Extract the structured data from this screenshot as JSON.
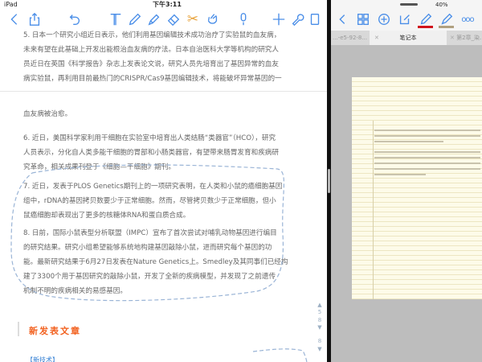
{
  "status_bar": {
    "device": "iPad",
    "time": "下午3:11",
    "battery": "40%"
  },
  "left_toolbar": {
    "icons": [
      "back-icon",
      "share-icon",
      "undo-icon",
      "text-icon",
      "pen-icon",
      "highlighter-icon",
      "eraser-icon",
      "scissors-icon",
      "hand-icon",
      "microphone-icon",
      "plus-icon",
      "wrench-icon",
      "page-icon"
    ],
    "active_color": "#e8a23a",
    "accent": "#4a8ee8"
  },
  "document": {
    "paragraphs": [
      [
        "5. 日本一个研究小组近日表示，他们利用基因编辑技术成功治疗了实验鼠的血友病，",
        "未来有望在此基础上开发出能根治血友病的疗法。日本自治医科大学等机构的研究人",
        "员近日在英国《科学报告》杂志上发表论文说，研究人员先培育出了基因异常的血友",
        "病实验鼠，再利用目前最热门的CRISPR/Cas9基因编辑技术，将能破坏异常基因的一"
      ],
      [
        "血友病被治愈。"
      ],
      [
        "6. 近日，美国科学家利用干细胞在实验室中培育出人类结肠“类器官”（HCO），研究",
        "人员表示，分化自人类多能干细胞的胃部和小肠类器官，有望带来肠胃发育和疾病研",
        "究革命，相关成果刊登于《细胞—干细胞》期刊。"
      ],
      [
        "7. 近日，发表于PLOS Genetics期刊上的一项研究表明，在人类和小鼠的癌细胞基因",
        "组中，rDNA的基因拷贝数要少于正常细胞。然而，尽管拷贝数少于正常细胞，但小",
        "鼠癌细胞却表现出了更多的核糖体RNA和蛋白质合成。"
      ],
      [
        "8. 日前，国际小鼠表型分析联盟（IMPC）宣布了首次尝试对哺乳动物基因进行编目",
        "的研究结果。研究小组希望能够系统地构建基因敲除小鼠，进而研究每个基因的功",
        "能。最新研究结果于6月27日发表在Nature Genetics上。Smedley及其同事们已经构",
        "建了3300个用于基因研究的敲除小鼠，开发了全新的疾病模型，并发现了之前遗传",
        "机制不明的疾病相关的易感基因。"
      ]
    ],
    "section_heading": "新发表文章",
    "tag": "【新技术】",
    "annotation_color": "#9ab4d6",
    "heading_color": "#f2601e"
  },
  "page_indicator": {
    "current": "5",
    "total": "8",
    "last": "8"
  },
  "right_toolbar": {
    "icons": [
      "back-icon",
      "grid-icon",
      "add-icon",
      "edit-icon",
      "pen-icon",
      "highlighter-icon",
      "more-icon"
    ],
    "pen_color": "#d0141c",
    "highlighter_color": "#b0a080"
  },
  "right_tabs": [
    {
      "label": "...-e5-92-8..."
    },
    {
      "label": "笔记本",
      "active": true
    },
    {
      "label": "第2章_染..."
    }
  ]
}
